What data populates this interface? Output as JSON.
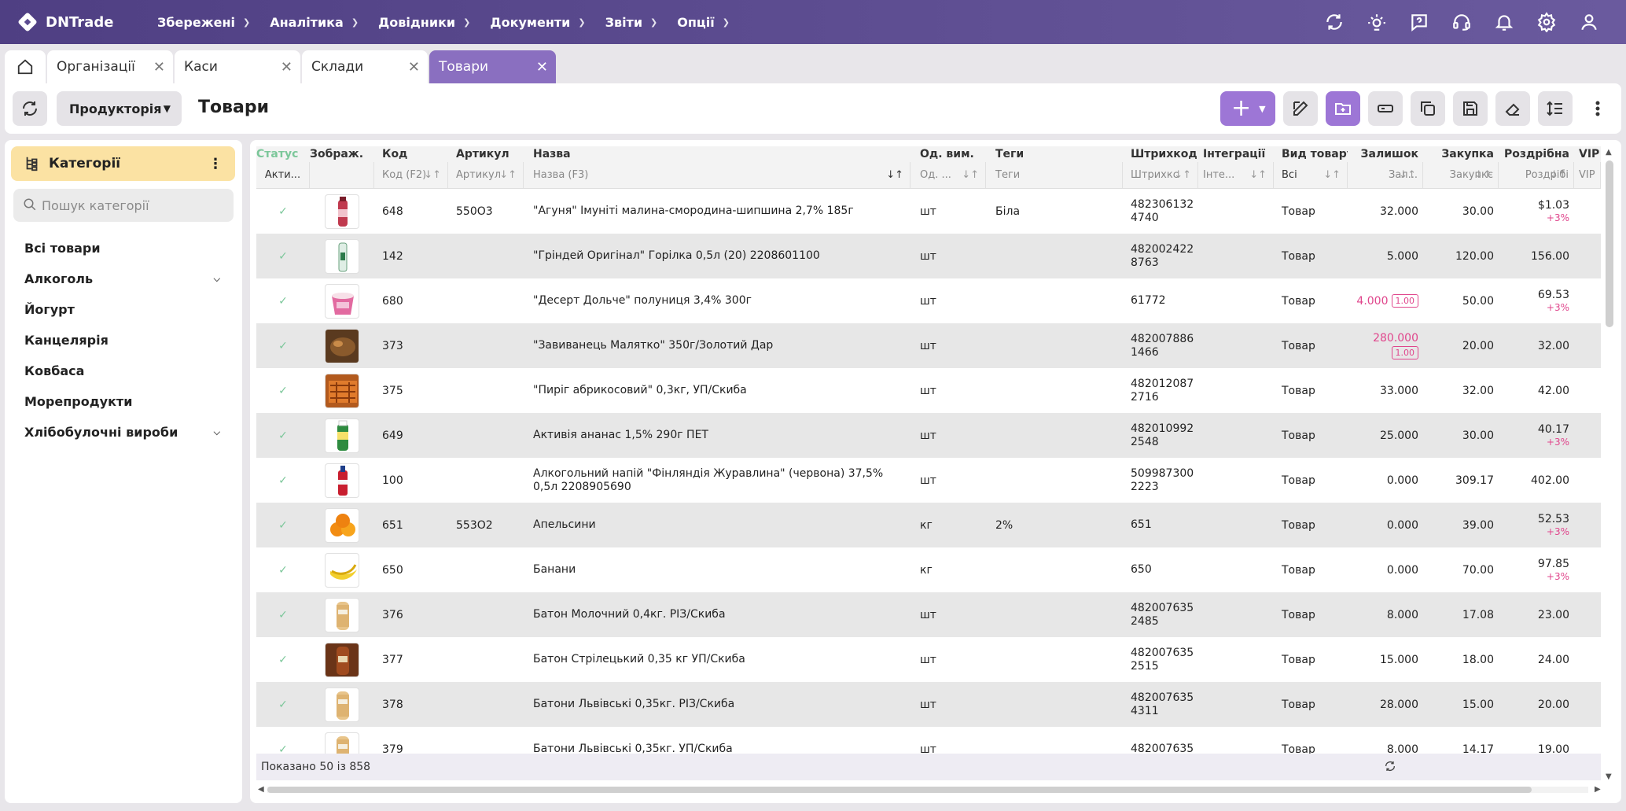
{
  "app": {
    "name": "DNTrade"
  },
  "menu": [
    {
      "label": "Збережені"
    },
    {
      "label": "Аналітика"
    },
    {
      "label": "Довідники"
    },
    {
      "label": "Документи"
    },
    {
      "label": "Звіти"
    },
    {
      "label": "Опції"
    }
  ],
  "top_icons": [
    "sync-icon",
    "theme-sun-icon",
    "help-icon",
    "support-headset-icon",
    "bell-icon",
    "settings-gear-icon",
    "user-icon"
  ],
  "tabs": [
    {
      "label": "Організації",
      "active": false
    },
    {
      "label": "Каси",
      "active": false
    },
    {
      "label": "Склади",
      "active": false
    },
    {
      "label": "Товари",
      "active": true
    }
  ],
  "toolbar": {
    "store_select": "Продукторія",
    "page_title": "Товари"
  },
  "sidebar": {
    "header": "Категорії",
    "search_placeholder": "Пошук категорії",
    "items": [
      {
        "label": "Всі товари",
        "expandable": false
      },
      {
        "label": "Алкоголь",
        "expandable": true
      },
      {
        "label": "Йогурт",
        "expandable": false
      },
      {
        "label": "Канцелярія",
        "expandable": false
      },
      {
        "label": "Ковбаса",
        "expandable": false
      },
      {
        "label": "Морепродукти",
        "expandable": false
      },
      {
        "label": "Хлібобулочні вироби",
        "expandable": true
      }
    ]
  },
  "table": {
    "columns": [
      {
        "key": "status",
        "label": "Статус",
        "filter": "Акти..."
      },
      {
        "key": "img",
        "label": "Зображ.",
        "filter": ""
      },
      {
        "key": "code",
        "label": "Код",
        "filter": "Код (F2)"
      },
      {
        "key": "art",
        "label": "Артикул",
        "filter": "Артикул"
      },
      {
        "key": "name",
        "label": "Назва",
        "filter": "Назва (F3)"
      },
      {
        "key": "unit",
        "label": "Од. вим.",
        "filter": "Од. ..."
      },
      {
        "key": "tags",
        "label": "Теги",
        "filter": "Теги"
      },
      {
        "key": "bar",
        "label": "Штрихкод",
        "filter": "Штрихкс"
      },
      {
        "key": "int",
        "label": "Інтеграції",
        "filter": "Інте..."
      },
      {
        "key": "kind",
        "label": "Вид товару",
        "filter": "Всі"
      },
      {
        "key": "rest",
        "label": "Залишок",
        "filter": "Зал..."
      },
      {
        "key": "buy",
        "label": "Закупка",
        "filter": "Закупкє"
      },
      {
        "key": "ret",
        "label": "Роздрібна",
        "filter": "Роздрібі"
      },
      {
        "key": "vip",
        "label": "VIP",
        "filter": "VIP"
      }
    ],
    "rows": [
      {
        "code": "648",
        "art": "550О3",
        "name": "\"Агуня\" Імуніті малина-смородина-шипшина 2,7% 185г",
        "unit": "шт",
        "tags": "Біла",
        "bar1": "482306132",
        "bar2": "4740",
        "kind": "Товар",
        "rest": "32.000",
        "rest_pink": false,
        "rest_badge": "",
        "buy": "30.00",
        "ret": "$1.03",
        "markup": "+3%",
        "thumb": "bottle-pink"
      },
      {
        "code": "142",
        "art": "",
        "name": "\"Гріндей Оригінал\" Горілка 0,5л (20) 2208601100",
        "unit": "шт",
        "tags": "",
        "bar1": "482002422",
        "bar2": "8763",
        "kind": "Товар",
        "rest": "5.000",
        "rest_pink": false,
        "rest_badge": "",
        "buy": "120.00",
        "ret": "156.00",
        "markup": "",
        "thumb": "bottle-clear"
      },
      {
        "code": "680",
        "art": "",
        "name": "\"Десерт Дольче\" полуниця 3,4% 300г",
        "unit": "шт",
        "tags": "",
        "bar1": "61772",
        "bar2": "",
        "kind": "Товар",
        "rest": "4.000",
        "rest_pink": true,
        "rest_badge": "1.00",
        "badge_inline": true,
        "buy": "50.00",
        "ret": "69.53",
        "markup": "+3%",
        "thumb": "cup"
      },
      {
        "code": "373",
        "art": "",
        "name": "\"Завиванець Малятко\" 350г/Золотий Дар",
        "unit": "шт",
        "tags": "",
        "bar1": "482007886",
        "bar2": "1466",
        "kind": "Товар",
        "rest": "280.000",
        "rest_pink": true,
        "rest_badge": "1.00",
        "badge_inline": false,
        "buy": "20.00",
        "ret": "32.00",
        "markup": "",
        "thumb": "bread-dark"
      },
      {
        "code": "375",
        "art": "",
        "name": "\"Пиріг абрикосовий\" 0,3кг, УП/Скиба",
        "unit": "шт",
        "tags": "",
        "bar1": "482012087",
        "bar2": "2716",
        "kind": "Товар",
        "rest": "33.000",
        "rest_pink": false,
        "rest_badge": "",
        "buy": "32.00",
        "ret": "42.00",
        "markup": "",
        "thumb": "pie"
      },
      {
        "code": "649",
        "art": "",
        "name": "Активія ананас 1,5% 290г ПЕТ",
        "unit": "шт",
        "tags": "",
        "bar1": "482010992",
        "bar2": "2548",
        "kind": "Товар",
        "rest": "25.000",
        "rest_pink": false,
        "rest_badge": "",
        "buy": "30.00",
        "ret": "40.17",
        "markup": "+3%",
        "thumb": "bottle-green"
      },
      {
        "code": "100",
        "art": "",
        "name": "Алкогольний напій \"Фінляндія Журавлина\" (червона) 37,5% 0,5л 2208905690",
        "unit": "шт",
        "tags": "",
        "bar1": "509987300",
        "bar2": "2223",
        "kind": "Товар",
        "rest": "0.000",
        "rest_pink": false,
        "rest_badge": "",
        "buy": "309.17",
        "ret": "402.00",
        "markup": "",
        "thumb": "bottle-red"
      },
      {
        "code": "651",
        "art": "553О2",
        "name": "Апельсини",
        "unit": "кг",
        "tags": "2%",
        "bar1": "651",
        "bar2": "",
        "kind": "Товар",
        "rest": "0.000",
        "rest_pink": false,
        "rest_badge": "",
        "buy": "39.00",
        "ret": "52.53",
        "markup": "+3%",
        "thumb": "orange"
      },
      {
        "code": "650",
        "art": "",
        "name": "Банани",
        "unit": "кг",
        "tags": "",
        "bar1": "650",
        "bar2": "",
        "kind": "Товар",
        "rest": "0.000",
        "rest_pink": false,
        "rest_badge": "",
        "buy": "70.00",
        "ret": "97.85",
        "markup": "+3%",
        "thumb": "banana"
      },
      {
        "code": "376",
        "art": "",
        "name": "Батон Молочний 0,4кг. РІЗ/Скиба",
        "unit": "шт",
        "tags": "",
        "bar1": "482007635",
        "bar2": "2485",
        "kind": "Товар",
        "rest": "8.000",
        "rest_pink": false,
        "rest_badge": "",
        "buy": "17.08",
        "ret": "23.00",
        "markup": "",
        "thumb": "loaf"
      },
      {
        "code": "377",
        "art": "",
        "name": "Батон Стрілецький 0,35 кг УП/Скиба",
        "unit": "шт",
        "tags": "",
        "bar1": "482007635",
        "bar2": "2515",
        "kind": "Товар",
        "rest": "15.000",
        "rest_pink": false,
        "rest_badge": "",
        "buy": "18.00",
        "ret": "24.00",
        "markup": "",
        "thumb": "loaf-dark"
      },
      {
        "code": "378",
        "art": "",
        "name": "Батони Львівські 0,35кг. РІЗ/Скиба",
        "unit": "шт",
        "tags": "",
        "bar1": "482007635",
        "bar2": "4311",
        "kind": "Товар",
        "rest": "28.000",
        "rest_pink": false,
        "rest_badge": "",
        "buy": "15.00",
        "ret": "20.00",
        "markup": "",
        "thumb": "loaf"
      },
      {
        "code": "379",
        "art": "",
        "name": "Батони Львівські 0,35кг. УП/Скиба",
        "unit": "шт",
        "tags": "",
        "bar1": "482007635",
        "bar2": "",
        "kind": "Товар",
        "rest": "8.000",
        "rest_pink": false,
        "rest_badge": "",
        "buy": "14.17",
        "ret": "19.00",
        "markup": "",
        "thumb": "loaf"
      }
    ]
  },
  "footer": {
    "shown": "Показано 50 із 858"
  },
  "colors": {
    "nav": "#5a4a8f",
    "accent": "#9d76d6",
    "active_tab": "#8a6fc0",
    "category_header": "#fbe2a3",
    "pink": "#e0468c",
    "status_check": "#7cc79a"
  }
}
